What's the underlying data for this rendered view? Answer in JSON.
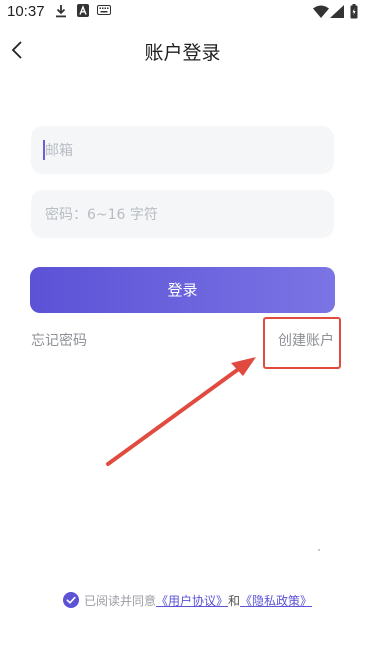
{
  "status_bar": {
    "time": "10:37",
    "icons": [
      "download-icon",
      "a-icon",
      "keyboard-icon",
      "wifi-icon",
      "signal-icon",
      "battery-icon"
    ]
  },
  "header": {
    "title": "账户登录",
    "back_icon": "chevron-left-icon"
  },
  "form": {
    "email_placeholder": "邮箱",
    "password_placeholder": "密码：6~16 字符",
    "login_label": "登录"
  },
  "links": {
    "forgot_password": "忘记密码",
    "create_account": "创建账户"
  },
  "agreement": {
    "checked": true,
    "prefix": "已阅读并同意",
    "user_agreement": "《用户协议》",
    "conjunction": "和",
    "privacy_policy": "《隐私政策》"
  },
  "colors": {
    "accent": "#5b52d6",
    "accent_end": "#7b74e4",
    "annotation": "#e04a3f",
    "field_bg": "#f5f6f8"
  }
}
